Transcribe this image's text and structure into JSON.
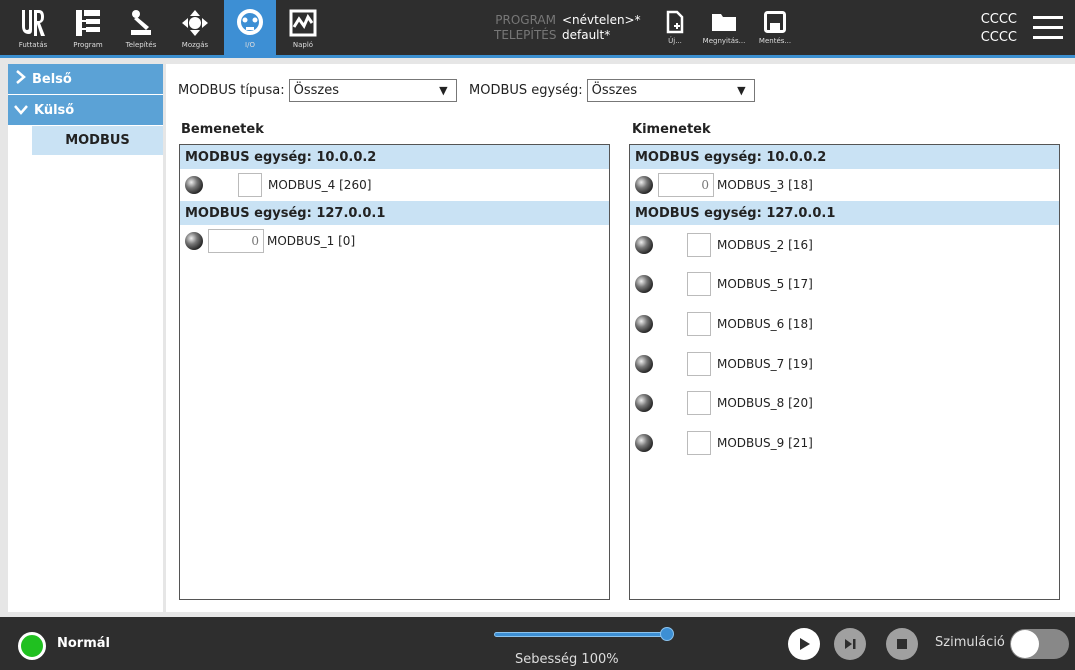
{
  "topbar": {
    "nav": [
      {
        "label": "Futtatás",
        "icon": "ur-logo-icon"
      },
      {
        "label": "Program",
        "icon": "program-tree-icon"
      },
      {
        "label": "Telepítés",
        "icon": "robot-arm-icon"
      },
      {
        "label": "Mozgás",
        "icon": "move-arrows-icon"
      },
      {
        "label": "I/O",
        "icon": "io-icon"
      },
      {
        "label": "Napló",
        "icon": "log-chart-icon"
      }
    ],
    "program_key": "PROGRAM",
    "program_value": "<névtelen>*",
    "install_key": "TELEPÍTÉS",
    "install_value": "default*",
    "file": [
      {
        "label": "Új...",
        "icon": "new-file-icon"
      },
      {
        "label": "Megnyitás...",
        "icon": "folder-icon"
      },
      {
        "label": "Mentés...",
        "icon": "save-icon"
      }
    ],
    "user_line1": "CCCC",
    "user_line2": "CCCC"
  },
  "sidebar": {
    "items": [
      {
        "label": "Belső"
      },
      {
        "label": "Külső"
      }
    ],
    "sub_item": "MODBUS"
  },
  "filters": {
    "type_label": "MODBUS típusa:",
    "type_value": "Összes",
    "unit_label": "MODBUS egység:",
    "unit_value": "Összes"
  },
  "inputs": {
    "title": "Bemenetek",
    "groups": [
      {
        "header": "MODBUS egység: 10.0.0.2",
        "rows": [
          {
            "name": "MODBUS_4 [260]"
          }
        ]
      },
      {
        "header": "MODBUS egység: 127.0.0.1",
        "rows": [
          {
            "value": "0",
            "name": "MODBUS_1 [0]"
          }
        ]
      }
    ]
  },
  "outputs": {
    "title": "Kimenetek",
    "groups": [
      {
        "header": "MODBUS egység: 10.0.0.2",
        "rows": [
          {
            "value": "0",
            "name": "MODBUS_3 [18]"
          }
        ]
      },
      {
        "header": "MODBUS egység: 127.0.0.1",
        "rows": [
          {
            "name": "MODBUS_2 [16]"
          },
          {
            "name": "MODBUS_5 [17]"
          },
          {
            "name": "MODBUS_6 [18]"
          },
          {
            "name": "MODBUS_7 [19]"
          },
          {
            "name": "MODBUS_8 [20]"
          },
          {
            "name": "MODBUS_9 [21]"
          }
        ]
      }
    ]
  },
  "bottombar": {
    "status": "Normál",
    "status_color": "#20c020",
    "speed_label": "Sebesség 100%",
    "speed_fraction": 1.0,
    "simulation_label": "Szimuláció"
  },
  "colors": {
    "accent": "#3d8fd4",
    "header_bg": "#c9e2f4",
    "topbar_bg": "#2e2e2e"
  }
}
